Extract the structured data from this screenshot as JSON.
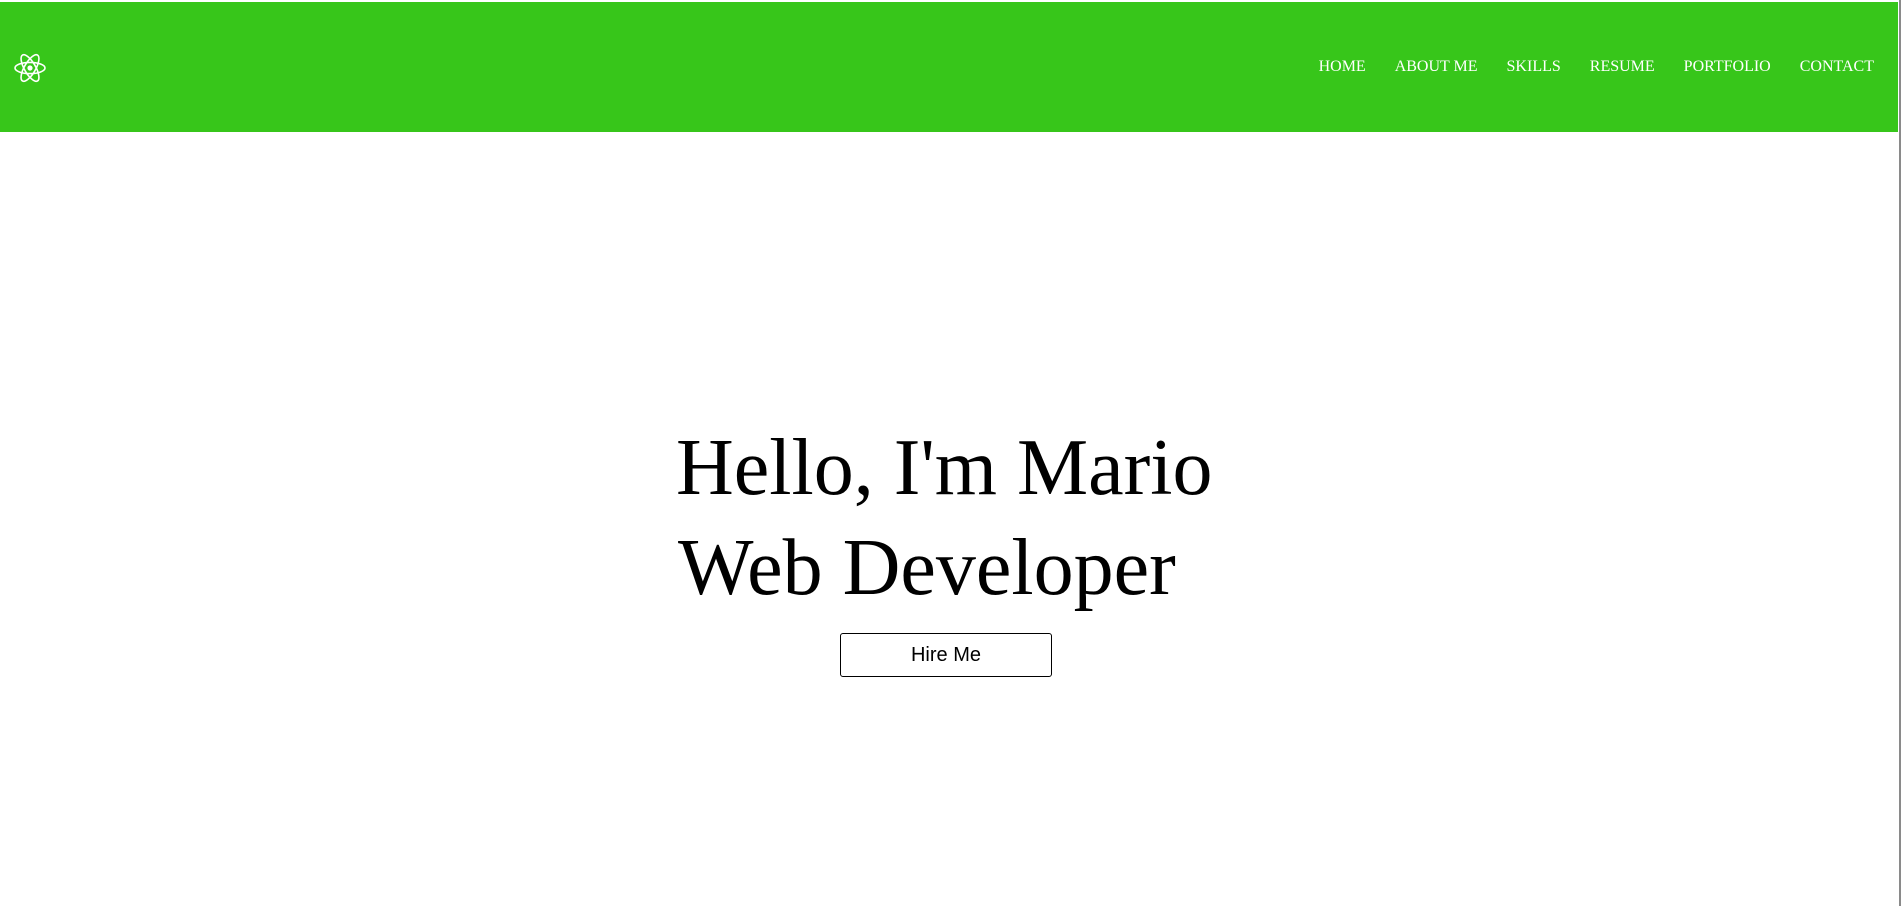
{
  "navbar": {
    "background_color": "#37c61a",
    "text_color": "#ffffff",
    "logo_icon": "react-atom-icon",
    "links": [
      {
        "label": "HOME"
      },
      {
        "label": "ABOUT ME"
      },
      {
        "label": "SKILLS"
      },
      {
        "label": "RESUME"
      },
      {
        "label": "PORTFOLIO"
      },
      {
        "label": "CONTACT"
      }
    ]
  },
  "hero": {
    "greeting": "Hello, I'm Mario",
    "role": "Web Developer",
    "cta_label": "Hire Me"
  }
}
